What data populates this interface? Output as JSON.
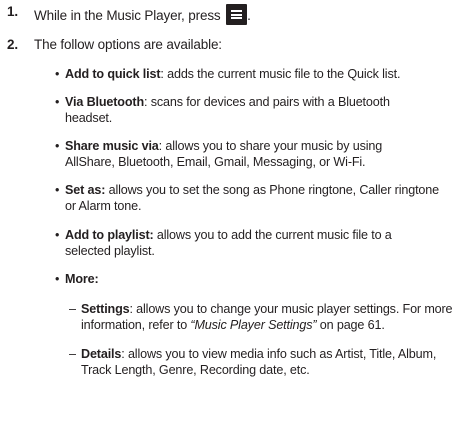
{
  "steps": [
    {
      "number": "1.",
      "text_before": "While in the Music Player, press",
      "icon": "menu-key-icon",
      "text_after": "."
    },
    {
      "number": "2.",
      "text": "The follow options are available:"
    }
  ],
  "options": [
    {
      "term": "Add to quick list",
      "sep": ":",
      "lines": [
        " adds the current music file to the Quick list."
      ]
    },
    {
      "term": "Via Bluetooth",
      "sep": ":",
      "lines": [
        " scans for devices and pairs with a Bluetooth",
        "headset."
      ]
    },
    {
      "term": "Share music via",
      "sep": ":",
      "lines": [
        " allows you to share your music by using",
        "AllShare, Bluetooth, Email, Gmail, Messaging, or Wi-Fi."
      ]
    },
    {
      "term": "Set as:",
      "sep": "",
      "lines": [
        " allows you to set the song as Phone ringtone, Caller ringtone",
        "or Alarm tone."
      ]
    },
    {
      "term": "Add to playlist:",
      "sep": "",
      "lines": [
        " allows you to add the current music file to a",
        "selected playlist."
      ]
    },
    {
      "term": "More:",
      "sep": "",
      "lines": [
        ""
      ]
    }
  ],
  "bullet_char": "•",
  "dash_char": "–",
  "more_items": [
    {
      "term": "Settings",
      "line1": ": allows you to change your music player settings. For more",
      "line2_before": "information, refer to ",
      "xref": "“Music Player Settings”",
      "line2_after": " on page 61."
    },
    {
      "term": "Details",
      "line1": ": allows you to view media info such as Artist, Title, Album,",
      "line2": "Track Length, Genre, Recording date, etc."
    }
  ]
}
